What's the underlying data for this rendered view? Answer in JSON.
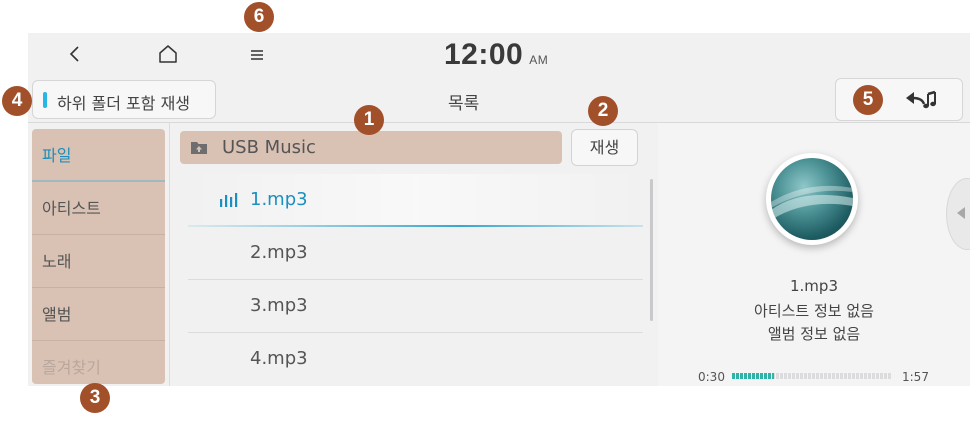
{
  "topbar": {
    "back_icon": "chevron-left-icon",
    "home_icon": "home-icon",
    "menu_icon": "menu-icon",
    "clock_time": "12:00",
    "clock_ampm": "AM"
  },
  "header": {
    "subfolder_toggle_label": "하위 폴더 포함 재생",
    "title": "목록",
    "back_to_music_icon": "back-music-icon"
  },
  "categories": [
    {
      "label": "파일",
      "state": "active"
    },
    {
      "label": "아티스트",
      "state": "normal"
    },
    {
      "label": "노래",
      "state": "normal"
    },
    {
      "label": "앨범",
      "state": "normal"
    },
    {
      "label": "즐겨찾기",
      "state": "disabled"
    }
  ],
  "path_bar": {
    "folder_icon": "folder-up-icon",
    "path": "USB Music"
  },
  "play_button_label": "재생",
  "files": [
    {
      "name": "1.mp3",
      "playing": true
    },
    {
      "name": "2.mp3",
      "playing": false
    },
    {
      "name": "3.mp3",
      "playing": false
    },
    {
      "name": "4.mp3",
      "playing": false
    }
  ],
  "now_playing": {
    "title": "1.mp3",
    "artist": "아티스트 정보 없음",
    "album": "앨범 정보 없음",
    "current_time": "0:30",
    "total_time": "1:57",
    "progress_fraction": 0.26
  },
  "callouts": [
    "1",
    "2",
    "3",
    "4",
    "5",
    "6"
  ],
  "colors": {
    "accent": "#1b8fc0",
    "highlight_bg": "#d9c2b4",
    "callout": "#a2502a",
    "progress": "#2fb3a9"
  }
}
